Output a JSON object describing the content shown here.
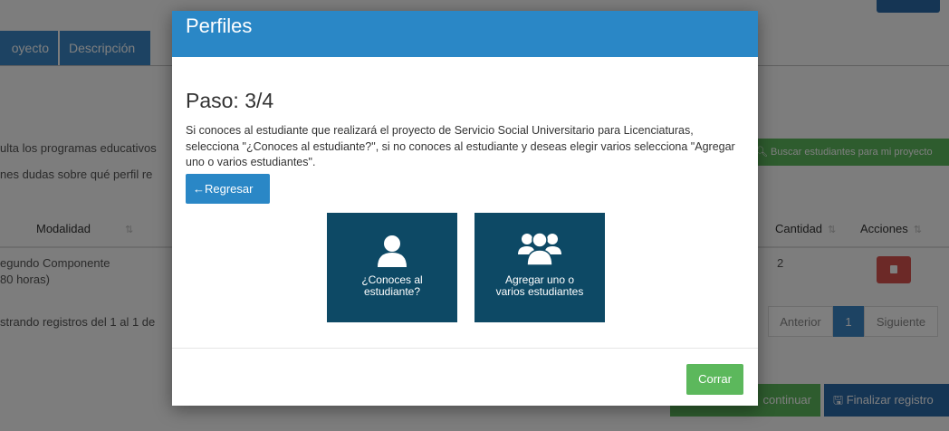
{
  "background": {
    "tabs": [
      "oyecto",
      "Descripción"
    ],
    "left_text_1": "ulta los programas educativos",
    "left_text_2": "nes dudas sobre qué perfil re",
    "search_students_button": "Buscar estudiantes para mi proyecto",
    "table": {
      "headers": {
        "modalidad": "Modalidad",
        "cantidad": "Cantidad",
        "acciones": "Acciones"
      },
      "row": {
        "modalidad_line1": "egundo Componente",
        "modalidad_line2": "80 horas)",
        "cantidad": "2"
      }
    },
    "records_info": "strando registros del 1 al 1 de",
    "pagination": {
      "prev": "Anterior",
      "current": "1",
      "next": "Siguiente"
    },
    "continue_button": "continuar",
    "finish_button": "Finalizar registro"
  },
  "modal": {
    "title": "Perfiles",
    "step": "Paso: 3/4",
    "instructions": "Si conoces al estudiante que realizará el proyecto de Servicio Social Universitario para Licenciaturas, selecciona \"¿Conoces al estudiante?\", si no conoces al estudiante y deseas elegir varios selecciona \"Agregar uno o varios estudiantes\".",
    "back_button": "Regresar",
    "option_know_student": {
      "line1": "¿Conoces al",
      "line2": "estudiante?"
    },
    "option_add_students": {
      "line1": "Agregar uno o",
      "line2": "varios estudiantes"
    },
    "close_button": "Corrar"
  },
  "colors": {
    "primary": "#2a87c6",
    "choice_card": "#0d4965",
    "success": "#5cb85c",
    "danger": "#d9534f"
  }
}
